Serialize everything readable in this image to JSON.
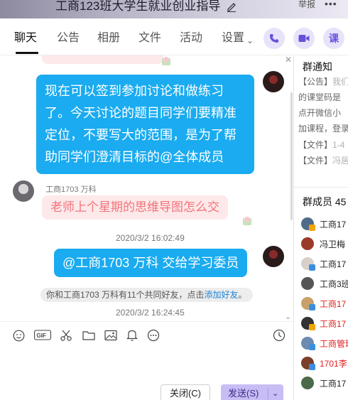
{
  "window": {
    "title": "工商123班大学生就业创业指导",
    "report_label": "举报",
    "more_label": "•••"
  },
  "tabs": [
    {
      "label": "聊天",
      "active": true
    },
    {
      "label": "公告"
    },
    {
      "label": "相册"
    },
    {
      "label": "文件"
    },
    {
      "label": "活动"
    },
    {
      "label": "设置"
    }
  ],
  "header_buttons": {
    "ke_label": "课"
  },
  "messages": {
    "partial_top": {
      "text": "……",
      "from": "student"
    },
    "teacher_1": {
      "text": "现在可以签到参加讨论和做练习了。今天讨论的题目同学们要精准定位，不要写大的范围，是为了帮助同学们澄清目标的@全体成员"
    },
    "student_1": {
      "sender": "工商1703 万科",
      "text": "老师上个星期的思维导图怎么交"
    },
    "time_1": "2020/3/2 16:02:49",
    "teacher_2": {
      "text": "@工商1703 万科 交给学习委员"
    },
    "system": {
      "prefix": "你和工商1703 万科有11个共同好友，点击",
      "link": "添加好友",
      "suffix": "。"
    },
    "time_2": "2020/3/2 16:24:45"
  },
  "buttons": {
    "close_label": "关闭(C)",
    "send_label": "发送(S)"
  },
  "right_panel": {
    "notice_title": "群通知",
    "notice_lines": [
      {
        "a": "【公告】",
        "b": "我们"
      },
      {
        "a": "的课堂码是",
        "b": ""
      },
      {
        "a": "点开微信小",
        "b": ""
      },
      {
        "a": "加课程，登录",
        "b": ""
      }
    ],
    "file_lines": [
      {
        "a": "【文件】",
        "b": "1-4"
      },
      {
        "a": "【文件】",
        "b": "冯居"
      }
    ],
    "members_title": "群成员 45",
    "members": [
      {
        "name": "工商17",
        "color": "#222",
        "av": "#4f6b8a",
        "badge": "#f0a500"
      },
      {
        "name": "冯卫梅",
        "color": "#222",
        "av": "#9a3b2a",
        "badge": ""
      },
      {
        "name": "工商17",
        "color": "#222",
        "av": "#d8d0c8",
        "badge": "#3a8ee0"
      },
      {
        "name": "工商3班",
        "color": "#222",
        "av": "#555",
        "badge": ""
      },
      {
        "name": "工商17",
        "color": "#e02020",
        "av": "#c9a06a",
        "badge": "#3a8ee0"
      },
      {
        "name": "工商17",
        "color": "#e02020",
        "av": "#333",
        "badge": "#f0a500"
      },
      {
        "name": "工商管理",
        "color": "#e02020",
        "av": "#6d8bb0",
        "badge": "#3a8ee0"
      },
      {
        "name": "1701李",
        "color": "#e02020",
        "av": "#7a3e2a",
        "badge": "#3a8ee0"
      },
      {
        "name": "工商17",
        "color": "#222",
        "av": "#4a6a4a",
        "badge": ""
      }
    ]
  },
  "colors": {
    "bubble_blue": "#1aabf0",
    "bubble_pink": "#fde9ea",
    "accent_purple": "#6a4fd9",
    "link_blue": "#1c84d8"
  }
}
